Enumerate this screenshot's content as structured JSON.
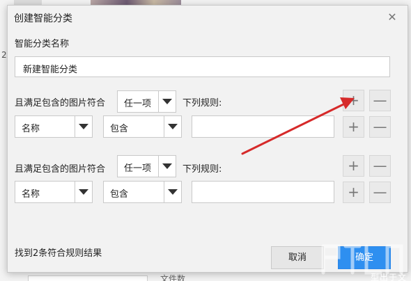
{
  "background": {
    "bottom_text": "文件数",
    "side_mark": "2"
  },
  "dialog": {
    "title": "创建智能分类",
    "close_icon": "close-icon",
    "name_label": "智能分类名称",
    "name_value": "新建智能分类",
    "rule_groups": [
      {
        "prefix": "且满足包含的图片符合",
        "match": "任一项",
        "suffix": "下列规则:",
        "rules": [
          {
            "field": "名称",
            "operator": "包含",
            "value": ""
          }
        ]
      },
      {
        "prefix": "且满足包含的图片符合",
        "match": "任一项",
        "suffix": "下列规则:",
        "rules": [
          {
            "field": "名称",
            "operator": "包含",
            "value": ""
          }
        ]
      }
    ],
    "plus": "+",
    "minus": "—",
    "result_text": "找到2条符合规则结果",
    "cancel_label": "取消",
    "ok_label": "确定"
  },
  "annotation": {
    "arrow_color": "#d62a2a"
  },
  "watermark": {
    "logo_icon": "watermark-logo-icon",
    "text": "型出于文"
  },
  "colors": {
    "accent": "#2e8ff0",
    "dialog_bg": "#f2f2f2",
    "border": "#c9c9c9"
  }
}
